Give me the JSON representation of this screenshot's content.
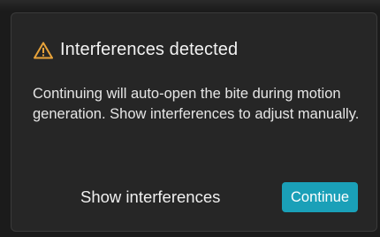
{
  "dialog": {
    "title": "Interferences detected",
    "warning_icon": "warning-triangle-icon",
    "warning_color": "#e8a33a",
    "message": "Continuing will auto-open the bite during motion generation. Show interferences to adjust manually.",
    "secondary_button_label": "Show interferences",
    "primary_button_label": "Continue",
    "primary_button_color": "#1aa0b8"
  }
}
